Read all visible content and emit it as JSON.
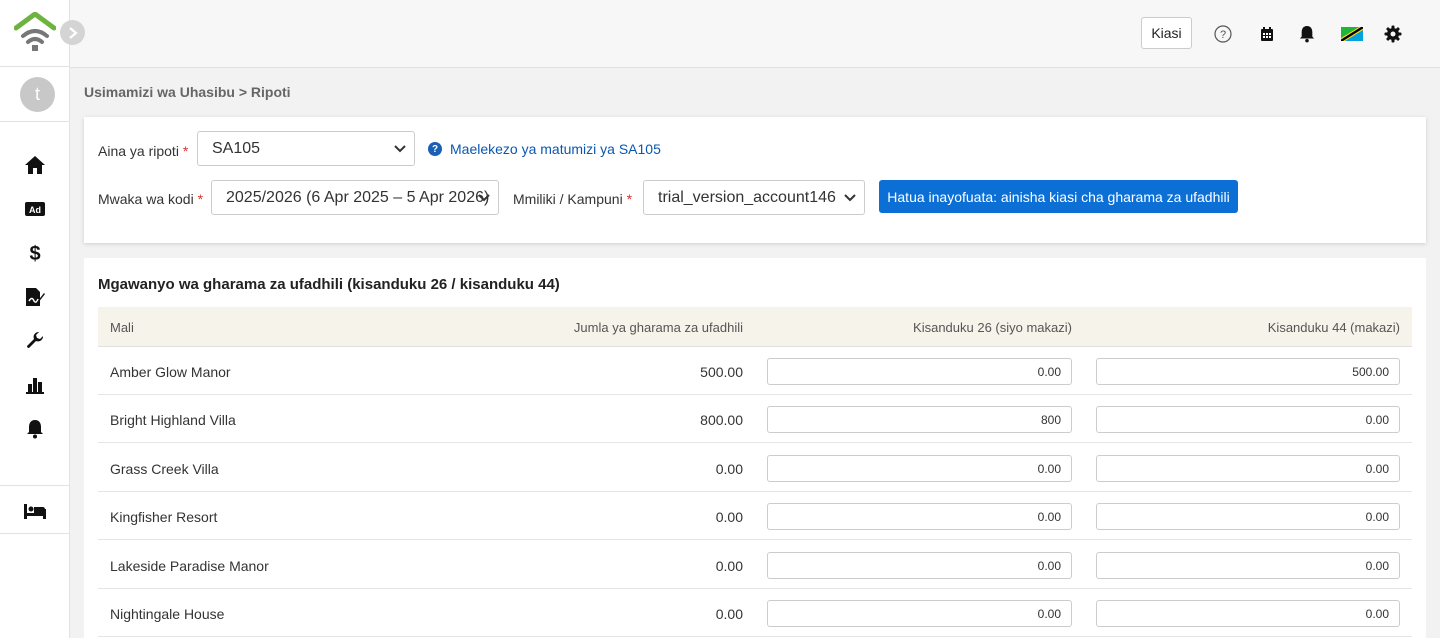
{
  "sidebar": {
    "avatar_initial": "t",
    "nav": [
      {
        "name": "home-icon"
      },
      {
        "name": "ad-icon",
        "text": "Ad"
      },
      {
        "name": "dollar-icon",
        "text": "$"
      },
      {
        "name": "signature-icon"
      },
      {
        "name": "wrench-icon"
      },
      {
        "name": "bar-chart-icon"
      },
      {
        "name": "bell-icon"
      },
      {
        "name": "bed-icon"
      }
    ]
  },
  "header": {
    "amount_button": "Kiasi",
    "icons": [
      "help-circle-icon",
      "calendar-icon",
      "bell-icon",
      "tanzania-flag-icon",
      "gear-icon"
    ]
  },
  "breadcrumb": "Usimamizi wa Uhasibu > Ripoti",
  "filters": {
    "report_type_label": "Aina ya ripoti",
    "report_type_value": "SA105",
    "help_link": "Maelekezo ya matumizi ya SA105",
    "tax_year_label": "Mwaka wa kodi",
    "tax_year_value": "2025/2026 (6 Apr 2025 – 5 Apr 2026)",
    "owner_label": "Mmiliki / Kampuni",
    "owner_value": "trial_version_account146",
    "required_mark": "*",
    "next_button": "Hatua inayofuata: ainisha kiasi cha gharama za ufadhili"
  },
  "table": {
    "title": "Mgawanyo wa gharama za ufadhili (kisanduku 26 / kisanduku 44)",
    "headers": {
      "property": "Mali",
      "total": "Jumla ya gharama za ufadhili",
      "box26": "Kisanduku 26 (siyo makazi)",
      "box44": "Kisanduku 44 (makazi)"
    },
    "rows": [
      {
        "property": "Amber Glow Manor",
        "total": "500.00",
        "box26": "0.00",
        "box44": "500.00"
      },
      {
        "property": "Bright Highland Villa",
        "total": "800.00",
        "box26": "800",
        "box44": "0.00"
      },
      {
        "property": "Grass Creek Villa",
        "total": "0.00",
        "box26": "0.00",
        "box44": "0.00"
      },
      {
        "property": "Kingfisher Resort",
        "total": "0.00",
        "box26": "0.00",
        "box44": "0.00"
      },
      {
        "property": "Lakeside Paradise Manor",
        "total": "0.00",
        "box26": "0.00",
        "box44": "0.00"
      },
      {
        "property": "Nightingale House",
        "total": "0.00",
        "box26": "0.00",
        "box44": "0.00"
      }
    ]
  },
  "colors": {
    "primary": "#0b6fd6",
    "logo_green": "#6db33f",
    "required": "#d9302c",
    "link": "#0b57b0"
  }
}
